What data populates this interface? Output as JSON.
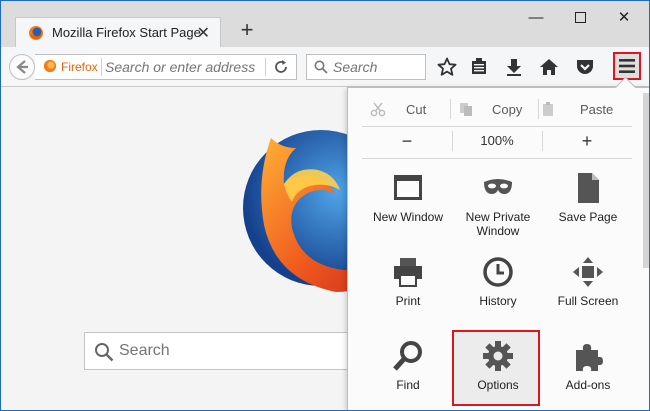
{
  "tab": {
    "title": "Mozilla Firefox Start Page"
  },
  "navbar": {
    "identity_label": "Firefox",
    "url_placeholder": "Search or enter address",
    "search_placeholder": "Search"
  },
  "content": {
    "search_placeholder": "Search"
  },
  "menu": {
    "edit": {
      "cut": "Cut",
      "copy": "Copy",
      "paste": "Paste"
    },
    "zoom": {
      "minus": "−",
      "level": "100%",
      "plus": "+"
    },
    "items": [
      {
        "label": "New Window",
        "icon": "window-icon"
      },
      {
        "label": "New Private Window",
        "icon": "mask-icon"
      },
      {
        "label": "Save Page",
        "icon": "page-icon"
      },
      {
        "label": "Print",
        "icon": "printer-icon"
      },
      {
        "label": "History",
        "icon": "clock-icon"
      },
      {
        "label": "Full Screen",
        "icon": "fullscreen-icon"
      },
      {
        "label": "Find",
        "icon": "magnifier-icon"
      },
      {
        "label": "Options",
        "icon": "gear-icon"
      },
      {
        "label": "Add-ons",
        "icon": "puzzle-icon"
      }
    ]
  },
  "colors": {
    "highlight": "#e0141e",
    "accent": "#e8620b"
  }
}
